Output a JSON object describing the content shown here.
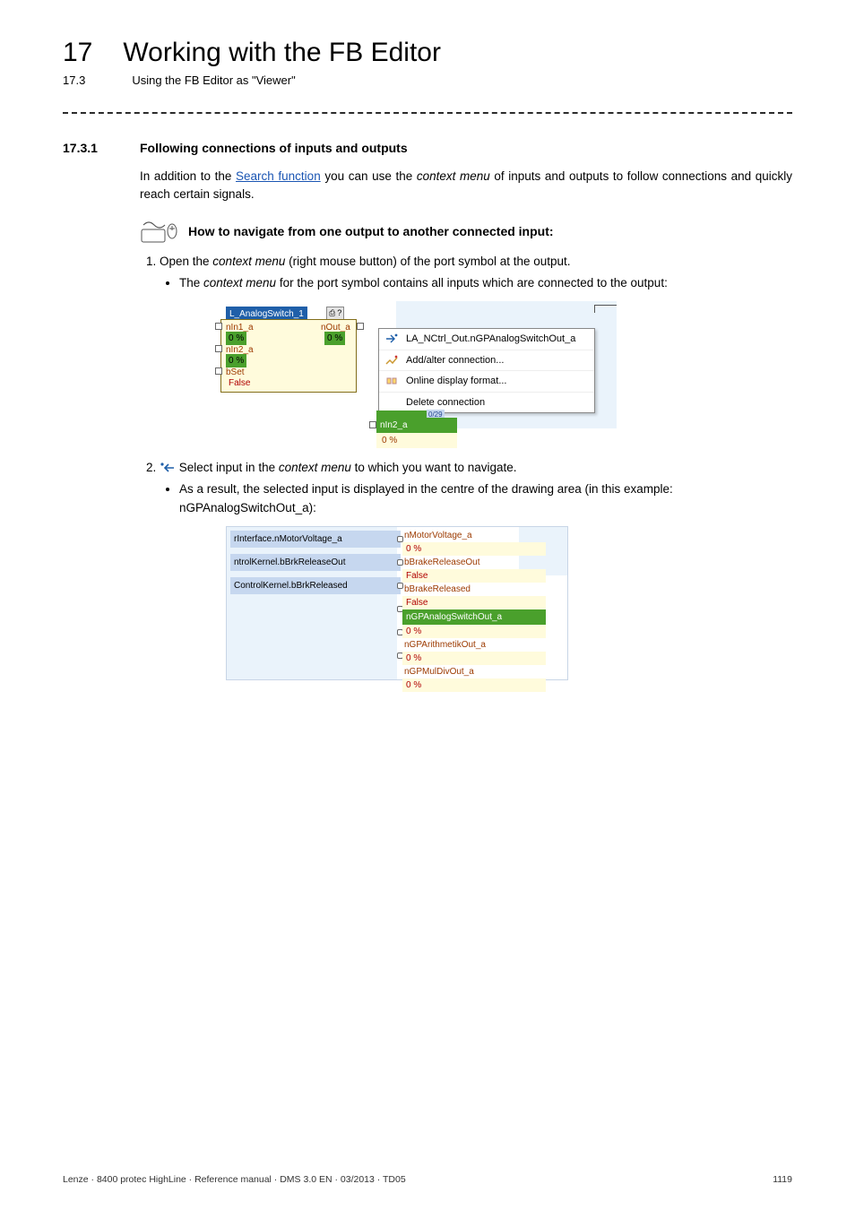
{
  "header": {
    "chapter_number": "17",
    "chapter_title": "Working with the FB Editor",
    "section_number": "17.3",
    "section_title": "Using the FB Editor as \"Viewer\""
  },
  "section": {
    "num": "17.3.1",
    "title": "Following connections of inputs and outputs"
  },
  "intro": {
    "pre": "In addition to the ",
    "link": "Search function",
    "mid": " you can use the ",
    "em": "context menu",
    "post": " of inputs and outputs to follow connections and quickly reach certain signals."
  },
  "howto": "How to navigate from one output to another connected input:",
  "steps": {
    "s1": {
      "pre": "Open the ",
      "em": "context menu",
      "post": " (right mouse button) of the port symbol at the output."
    },
    "s1_bullet": {
      "pre": "The ",
      "em": "context menu",
      "post": " for the port symbol contains all inputs which are connected to the output:"
    },
    "s2": {
      "pre": "Select input in the ",
      "em": "context menu",
      "post": " to which you want to navigate."
    },
    "s2_bullet": "As a result, the selected input is displayed in the centre of the drawing area (in this example: nGPAnalogSwitchOut_a):"
  },
  "fig1": {
    "block_title": "L_AnalogSwitch_1",
    "toolbar": {
      "a": "⎙",
      "b": "?"
    },
    "ports": {
      "nIn1_a": "nIn1_a",
      "nIn1_val": "0 %",
      "nIn2_a": "nIn2_a",
      "nIn2_val": "0 %",
      "bSet": "bSet",
      "bSet_val": "False",
      "nOut_a": "nOut_a",
      "nOut_val": "0 %"
    },
    "ctx": {
      "item1": "LA_NCtrl_Out.nGPAnalogSwitchOut_a",
      "item2": "Add/alter connection...",
      "item3": "Online display format...",
      "item4": "Delete connection"
    },
    "below_badge": "0/29",
    "below_name": "nIn2_a",
    "below_val": "0 %"
  },
  "fig2": {
    "left": {
      "l1": "rInterface.nMotorVoltage_a",
      "l2": "ntrolKernel.bBrkReleaseOut",
      "l3": "ControlKernel.bBrkReleased"
    },
    "right": [
      {
        "name": "nMotorVoltage_a",
        "val": "0 %"
      },
      {
        "name": "bBrakeReleaseOut",
        "val": "False"
      },
      {
        "name": "bBrakeReleased",
        "val": "False"
      },
      {
        "name": "nGPAnalogSwitchOut_a",
        "val": "0 %",
        "hl": true
      },
      {
        "name": "nGPArithmetikOut_a",
        "val": "0 %"
      },
      {
        "name": "nGPMulDivOut_a",
        "val": "0 %"
      }
    ]
  },
  "footer": {
    "left": "Lenze · 8400 protec HighLine · Reference manual · DMS 3.0 EN · 03/2013 · TD05",
    "right": "1119"
  }
}
